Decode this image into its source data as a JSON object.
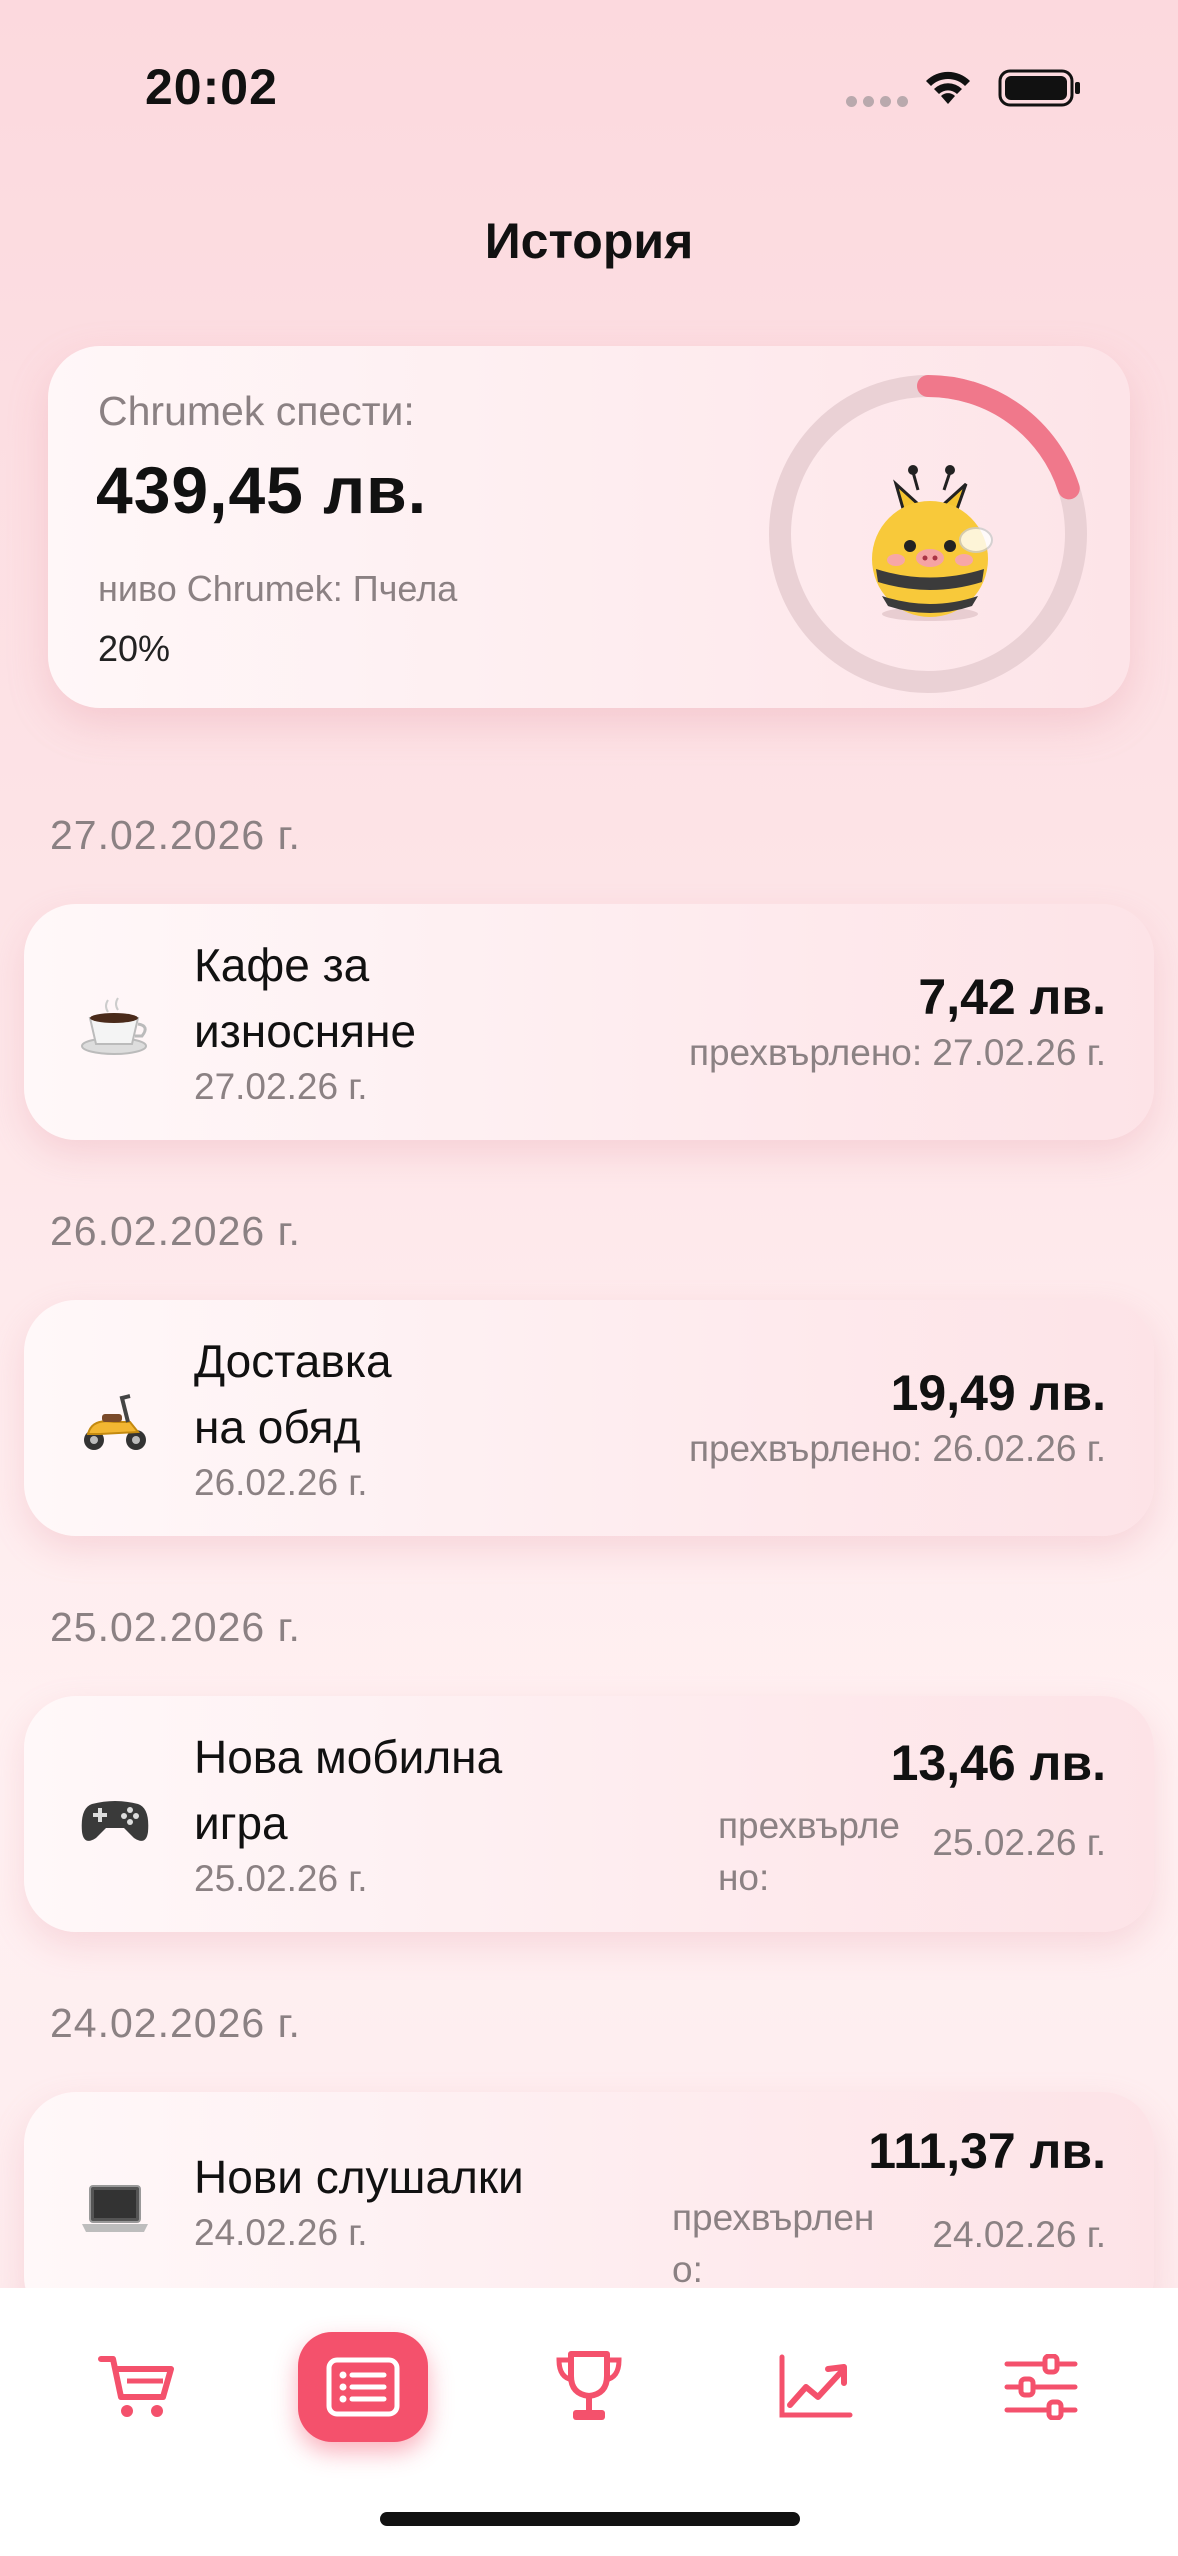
{
  "status_bar": {
    "time": "20:02"
  },
  "header": {
    "title": "История"
  },
  "summary": {
    "saved_label": "Chrumek спести:",
    "saved_amount": "439,45 лв.",
    "level_label": "ниво Chrumek: Пчела",
    "level_percent": "20%",
    "progress_fraction": 0.2,
    "accent_color": "#f0788b"
  },
  "groups": [
    {
      "date": "27.02.2026 г.",
      "transactions": [
        {
          "icon": "coffee-icon",
          "title": "Кафе за износ​няне",
          "title_display": "Кафе за износняне",
          "date": "27.02.26 г.",
          "amount": "7,42 лв.",
          "transfer_label": "прехвърлено:",
          "transfer_date": "27.02.26 г."
        }
      ]
    },
    {
      "date": "26.02.2026 г.",
      "transactions": [
        {
          "icon": "scooter-icon",
          "title": "Доставка на обяд",
          "date": "26.02.26 г.",
          "amount": "19,49 лв.",
          "transfer_label": "прехвърлено:",
          "transfer_date": "26.02.26 г."
        }
      ]
    },
    {
      "date": "25.02.2026 г.",
      "transactions": [
        {
          "icon": "gamepad-icon",
          "title": "Нова мобилна игра",
          "date": "25.02.26 г.",
          "amount": "13,46 лв.",
          "transfer_label": "прехвърлено:",
          "transfer_date": "25.02.26 г."
        }
      ]
    },
    {
      "date": "24.02.2026 г.",
      "transactions": [
        {
          "icon": "laptop-icon",
          "title": "Нови слушалки",
          "date": "24.02.26 г.",
          "amount": "111,37 лв.",
          "transfer_label": "прехвърлено:",
          "transfer_date": "24.02.26 г."
        }
      ]
    }
  ],
  "tab_bar": {
    "tabs": [
      {
        "icon": "cart-icon",
        "active": false
      },
      {
        "icon": "list-icon",
        "active": true
      },
      {
        "icon": "trophy-icon",
        "active": false
      },
      {
        "icon": "chart-icon",
        "active": false
      },
      {
        "icon": "sliders-icon",
        "active": false
      }
    ],
    "accent_color": "#f4516c"
  }
}
